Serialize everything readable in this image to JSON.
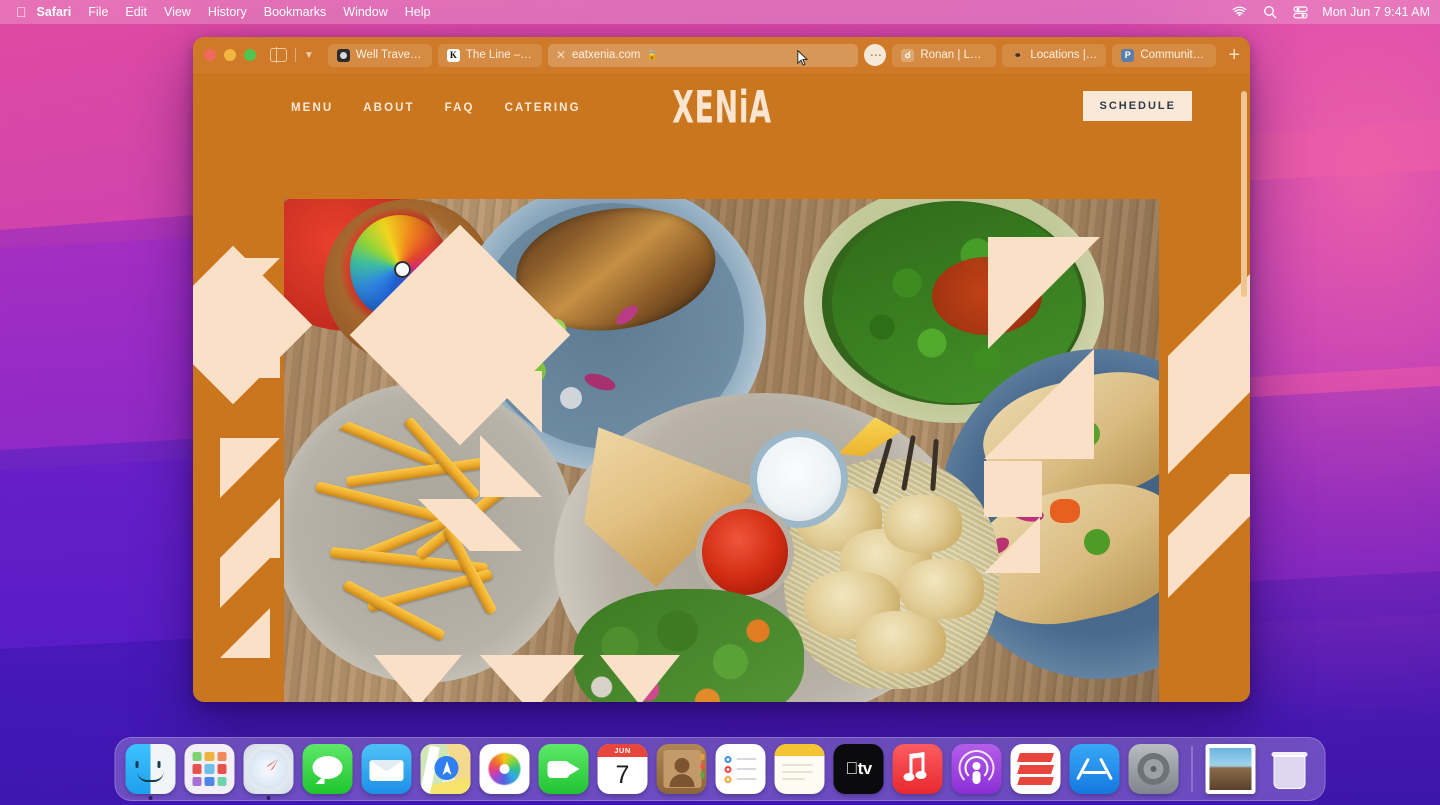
{
  "menubar": {
    "apple_icon": "apple-logo",
    "items": [
      "Safari",
      "File",
      "Edit",
      "View",
      "History",
      "Bookmarks",
      "Window",
      "Help"
    ],
    "status_icons": [
      "wifi-icon",
      "search-icon",
      "control-center-icon"
    ],
    "clock": "Mon Jun 7  9:41 AM"
  },
  "browser": {
    "window_controls": [
      "close",
      "minimize",
      "zoom"
    ],
    "sidebar_icon": "sidebar-toggle-icon",
    "chevron_icon": "chevron-down-icon",
    "new_tab_icon": "plus-icon",
    "overflow_icon": "ellipsis-icon",
    "tabs": [
      {
        "label": "Well Traveled | Th…",
        "favicon": "dark-circle-favicon",
        "active": false
      },
      {
        "label": "The Line – Kinfolk",
        "favicon": "letter-k-favicon",
        "active": false
      },
      {
        "label": "eatxenia.com",
        "favicon": "lock-icon",
        "active": true,
        "close_icon": "close-icon"
      },
      {
        "label": "Ronan | Los Ange…",
        "favicon": "ronan-favicon",
        "active": false
      },
      {
        "label": "Locations | Dune",
        "favicon": "dune-favicon",
        "active": false
      },
      {
        "label": "Community – Plat…",
        "favicon": "letter-p-favicon",
        "active": false
      }
    ]
  },
  "site": {
    "brand": "XENiA",
    "nav": [
      {
        "label": "MENU"
      },
      {
        "label": "ABOUT"
      },
      {
        "label": "FAQ"
      },
      {
        "label": "CATERING"
      }
    ],
    "cta": "SCHEDULE",
    "hero_alt": "Overhead spread of Mediterranean dishes: grilled eggplant salad, broccolini, french fries, chicken skewers with rice, pita, tzatziki and hot sauce",
    "colors": {
      "background": "#c9761f",
      "cream": "#fbe0c8",
      "text_cream": "#fbe9d8",
      "cta_text": "#2d3a4a"
    }
  },
  "dock": {
    "items": [
      {
        "name": "finder",
        "running": true
      },
      {
        "name": "launchpad",
        "running": false
      },
      {
        "name": "safari",
        "running": true
      },
      {
        "name": "messages",
        "running": false
      },
      {
        "name": "mail",
        "running": false
      },
      {
        "name": "maps",
        "running": false
      },
      {
        "name": "photos",
        "running": false
      },
      {
        "name": "facetime",
        "running": false
      },
      {
        "name": "calendar",
        "running": false,
        "month": "JUN",
        "day": "7"
      },
      {
        "name": "contacts",
        "running": false
      },
      {
        "name": "reminders",
        "running": false
      },
      {
        "name": "notes",
        "running": false
      },
      {
        "name": "apple-tv",
        "running": false,
        "label": "tv"
      },
      {
        "name": "music",
        "running": false
      },
      {
        "name": "podcasts",
        "running": false
      },
      {
        "name": "news",
        "running": false
      },
      {
        "name": "app-store",
        "running": false
      },
      {
        "name": "system-preferences",
        "running": false
      }
    ],
    "extras": [
      {
        "name": "photo-file"
      },
      {
        "name": "trash"
      }
    ]
  }
}
